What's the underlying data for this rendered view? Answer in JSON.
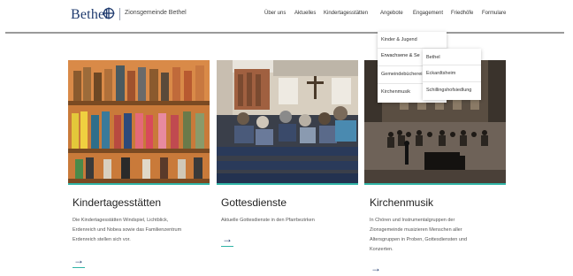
{
  "header": {
    "logo_text": "Bethel",
    "site_name": "Zionsgemeinde Bethel"
  },
  "nav": {
    "items": [
      "Über uns",
      "Aktuelles",
      "Kindertagesstätten",
      "Angebote",
      "Engagement",
      "Friedhöfe",
      "Formulare"
    ]
  },
  "dropdown": {
    "items": [
      "Kinder & Jugend",
      "Erwachsene & Se",
      "Gemeindebücherei",
      "Kirchenmusik"
    ],
    "submenu": [
      "Bethel",
      "Eckardtsheim",
      "Schillingshofsiedlung"
    ]
  },
  "cards": [
    {
      "title": "Kindertagesstätten",
      "text": [
        "Die Kindertagesstätten Windspiel, Lichtblick,",
        "Erdenreich und Nobea sowie das Familienzentrum",
        "Erdenreich stellen sich vor."
      ],
      "arrow": "→"
    },
    {
      "title": "Gottesdienste",
      "text": [
        "Aktuelle Gottesdienste in den Pfarrbezirken"
      ],
      "arrow": "→"
    },
    {
      "title": "Kirchenmusik",
      "text": [
        "In Chören und Instrumentalgruppen der",
        "Zionsgemeinde musizieren Menschen aller",
        "Altersgruppen in Proben, Gottesdiensten und",
        "Konzerten."
      ],
      "arrow": "→"
    }
  ],
  "colors": {
    "brand": "#1e3a6e",
    "accent": "#30b4a6"
  },
  "icons": {
    "logo": "bethel-cross-emblem-icon",
    "card_link": "arrow-right-icon"
  }
}
